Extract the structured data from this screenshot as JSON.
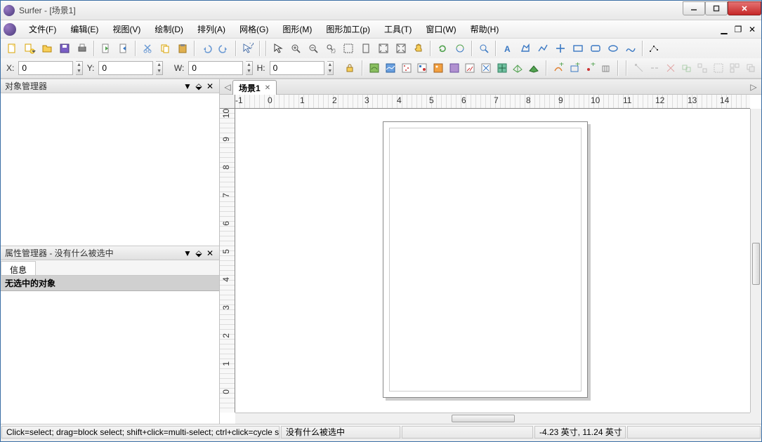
{
  "title": "Surfer - [场景1]",
  "menus": [
    "文件(F)",
    "编辑(E)",
    "视图(V)",
    "绘制(D)",
    "排列(A)",
    "网格(G)",
    "图形(M)",
    "图形加工(p)",
    "工具(T)",
    "窗口(W)",
    "帮助(H)"
  ],
  "coords": {
    "x_label": "X:",
    "x_val": "0",
    "y_label": "Y:",
    "y_val": "0",
    "w_label": "W:",
    "w_val": "0",
    "h_label": "H:",
    "h_val": "0"
  },
  "object_manager_title": "对象管理器",
  "property_manager_title": "属性管理器 - 没有什么被选中",
  "prop_tab": "信息",
  "prop_content_header": "无选中的对象",
  "doc_tab": "场景1",
  "status": {
    "hint": "Click=select; drag=block select; shift+click=multi-select; ctrl+click=cycle sel...",
    "selection": "没有什么被选中",
    "coords": "-4.23 英寸, 11.24 英寸"
  },
  "ruler_h": [
    "-1",
    "0",
    "1",
    "2",
    "3",
    "4",
    "5",
    "6",
    "7",
    "8",
    "9",
    "10",
    "11",
    "12",
    "13",
    "14"
  ],
  "ruler_v": [
    "10",
    "9",
    "8",
    "7",
    "6",
    "5",
    "4",
    "3",
    "2",
    "1",
    "0"
  ]
}
